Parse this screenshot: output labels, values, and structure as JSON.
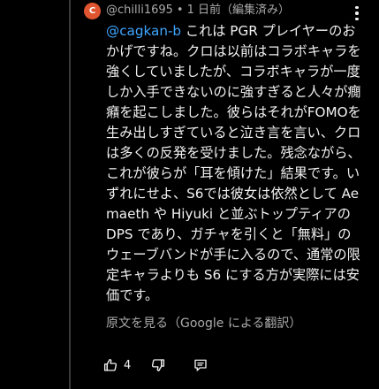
{
  "comment": {
    "avatar_letter": "C",
    "avatar_color": "#e0552f",
    "author": "@chilli1695",
    "separator": "•",
    "timestamp": "1 日前",
    "edited": "（編集済み）",
    "mention": "@cagkan-b",
    "text": " これは PGR プレイヤーのおかげですね。クロは以前はコラボキャラを強くしていましたが、コラボキャラが一度しか入手できないのに強すぎると人々が癇癪を起こしました。彼らはそれがFOMOを生み出しすぎていると泣き言を言い、クロは多くの反発を受けました。残念ながら、これが彼らが「耳を傾けた」結果です。いずれにせよ、S6では彼女は依然として Aemaeth や Hiyuki と並ぶトップティアの DPS であり、ガチャを引くと「無料」のウェーブバンドが手に入るので、通常の限定キャラよりも S6 にする方が実際には安価です。",
    "translate_link": "原文を見る（Google による翻訳）",
    "like_count": "4"
  },
  "colors": {
    "background": "#000000",
    "text": "#f1f1f1",
    "secondary": "#aaaaaa",
    "link": "#3ea6ff",
    "thread_line": "#3a3a3a"
  },
  "icons": {
    "like": "thumb-up-icon",
    "dislike": "thumb-down-icon",
    "reply": "reply-comment-icon",
    "menu": "more-vert-icon"
  }
}
